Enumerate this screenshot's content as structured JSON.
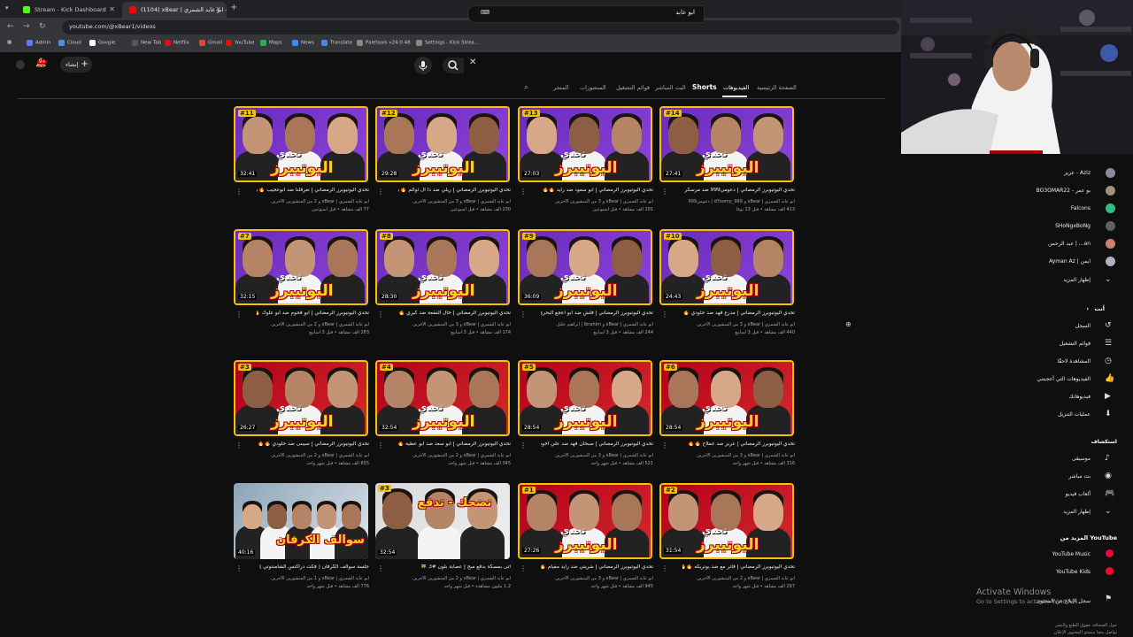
{
  "browser": {
    "tabs": [
      {
        "title": "Stream - Kick Dashboard",
        "icon": "kick-icon",
        "color": "#53fc18"
      },
      {
        "title": "(1104) xBear | ابو عابد الشمري - Y",
        "icon": "youtube-icon",
        "color": "#ff0000"
      }
    ],
    "url": "youtube.com/@xBear1/videos",
    "bookmarks": [
      {
        "label": "Admin",
        "color": "#5b7cfa"
      },
      {
        "label": "Cloud",
        "color": "#4a90e2"
      },
      {
        "label": "Google",
        "color": "#ffffff"
      },
      {
        "label": "New Tab",
        "color": "#555"
      },
      {
        "label": "Netflix",
        "color": "#e50914"
      },
      {
        "label": "Gmail",
        "color": "#ea4335"
      },
      {
        "label": "YouTube",
        "color": "#ff0000"
      },
      {
        "label": "Maps",
        "color": "#34a853"
      },
      {
        "label": "News",
        "color": "#4285f4"
      },
      {
        "label": "Translate",
        "color": "#4285f4"
      },
      {
        "label": "Paletools v24.0.48",
        "color": "#888"
      },
      {
        "label": "Settings - Kick Strea...",
        "color": "#888"
      }
    ]
  },
  "header": {
    "search_query": "ابو عابد",
    "create_label": "إنشاء",
    "notification_count": "9+"
  },
  "channel_tabs": [
    "الصفحة الرئيسية",
    "الفيديوهات",
    "Shorts",
    "البث المباشر",
    "قوائم التشغيل",
    "المنشورات",
    "المتجر"
  ],
  "videos": [
    {
      "title": "تحدي اليوتيوبرز الرمضاني | تعرقلنا ضد ابوعجيب 🔥🔥",
      "meta1": "ابو عابد الشمري | xBear و 2 من المنشورين الآخرين",
      "meta2": "77 ألف مشاهد • قبل أسبوعين",
      "duration": "32:41",
      "ep": "#11",
      "theme": "purple"
    },
    {
      "title": "تحدي اليوتيوبرز الرمضاني | ريلي ضد ذا ال ثوالم 🔥🔥",
      "meta1": "ابو عابد الشمري | xBear و 3 من المنشورين الآخرين",
      "meta2": "230 ألف مشاهد • قبل أسبوعين",
      "duration": "29:28",
      "ep": "#12",
      "theme": "purple"
    },
    {
      "title": "تحدي اليوتيوبرز الرمضاني | ابو سعود ضد رايد 🔥🔥",
      "meta1": "ابو عابد الشمري | xBear و 3 من المنشورين الآخرين",
      "meta2": "291 ألف مشاهد • قبل أسبوعين",
      "duration": "27:03",
      "ep": "#13",
      "theme": "purple"
    },
    {
      "title": "تحدي اليوتيوبرز الرمضاني | دعومي999 ضد مرسكر 🔥🔥",
      "meta1": "ابو عابد الشمري | xBear و d7oomy_999 | دعومي999",
      "meta2": "413 ألف مشاهد • قبل 13 يومًا",
      "duration": "27:41",
      "ep": "#14",
      "theme": "purple"
    },
    {
      "title": "تحدي اليوتيوبرز الرمضاني | ابو فحوم ضد ابو علوك 🔥🔥",
      "meta1": "ابو عابد الشمري | xBear و 2 من المنشورين الآخرين",
      "meta2": "283 ألف مشاهد • قبل 3 أسابيع",
      "duration": "32:15",
      "ep": "#7",
      "theme": "purple"
    },
    {
      "title": "تحدي اليوتيوبرز الرمضاني | خال الفقعة ضد كيري 🔥🔥",
      "meta1": "ابو عابد الشمري | xBear و 3 من المنشورين الآخرين",
      "meta2": "174 ألف مشاهد • قبل 3 أسابيع",
      "duration": "28:30",
      "ep": "#8",
      "theme": "purple"
    },
    {
      "title": "تحدي اليوتيوبرز الرمضاني | فلش ضد ابو اعجع البحري 🔥",
      "meta1": "ابو عابد الشمري | xBear و Ibrahim | ابراهيم خليل",
      "meta2": "244 ألف مشاهد • قبل 3 أسابيع",
      "duration": "36:09",
      "ep": "#9",
      "theme": "purple"
    },
    {
      "title": "تحدي اليوتيوبرز الرمضاني | مدرع فهد ضد حلودي 🔥🔥",
      "meta1": "ابو عابد الشمري | xBear و 3 من المنشورين الآخرين",
      "meta2": "440 ألف مشاهد • قبل 3 أسابيع",
      "duration": "24:43",
      "ep": "#10",
      "theme": "purple"
    },
    {
      "title": "تحدي اليوتيوبرز الرمضاني | سيبنى ضد حلودي 🔥🔥",
      "meta1": "ابو عابد الشمري | xBear و 2 من المنشورين الآخرين",
      "meta2": "655 ألف مشاهد • قبل شهر واحد",
      "duration": "26:27",
      "ep": "#3",
      "theme": "red"
    },
    {
      "title": "تحدي اليوتيوبرز الرمضاني | ابو سعد ضد ابو عطية 🔥🔥",
      "meta1": "ابو عابد الشمري | xBear و 2 من المنشورين الآخرين",
      "meta2": "345 ألف مشاهد • قبل شهر واحد",
      "duration": "32:54",
      "ep": "#4",
      "theme": "red"
    },
    {
      "title": "تحدي اليوتيوبرز الرمضاني | سبحان فهد ضد علي اخوه 🔥🔥",
      "meta1": "ابو عابد الشمري | xBear و 3 من المنشورين الآخرين",
      "meta2": "521 ألف مشاهد • قبل شهر واحد",
      "duration": "28:54",
      "ep": "#5",
      "theme": "red"
    },
    {
      "title": "تحدي اليوتيوبرز الرمضاني | عزيز ضد عملاح 🔥🔥",
      "meta1": "ابو عابد الشمري | xBear و 3 من المنشورين الآخرين",
      "meta2": "316 ألف مشاهد • قبل شهر واحد",
      "duration": "28:54",
      "ep": "#6",
      "theme": "red"
    },
    {
      "title": "جلسة سوالف الكرفان ( فكت دراكنس الشامنتوتي ) 🔥",
      "meta1": "ابو عابد الشمري | xBear و 1 من المنشورين الآخرين",
      "meta2": "776 ألف مشاهد • قبل شهر واحد",
      "duration": "40:16",
      "ep": "",
      "theme": "photo",
      "overlay": "سوالف الكرفان"
    },
    {
      "title": "اتى بمسكة بدقع سح | عصابة بلون #3 🍀",
      "meta1": "ابو عابد الشمري | xBear و 2 من المنشورين الآخرين",
      "meta2": "1.2 مليون مشاهدة • قبل شهر واحد",
      "duration": "32:54",
      "ep": "#3",
      "theme": "photo2",
      "overlay": "تضحك - تدفع"
    },
    {
      "title": "تحدي اليوتيوبرز الرمضاني | شريتي ضد رايد مقيام 🔥🔥",
      "meta1": "ابو عابد الشمري | xBear و 3 من المنشورين الآخرين",
      "meta2": "945 ألف مشاهد • قبل شهر واحد",
      "duration": "27:26",
      "ep": "#1",
      "theme": "red"
    },
    {
      "title": "تحدي اليوتيوبرز الرمضاني | فاتر مع ضد بوتريكه 🔥🔥",
      "meta1": "ابو عابد الشمري | xBear و 2 من المنشورين الآخرين",
      "meta2": "297 ألف مشاهد • قبل شهر واحد",
      "duration": "31:54",
      "ep": "#2",
      "theme": "red"
    }
  ],
  "thumb_overlay": {
    "top": "تحدي",
    "bottom": "اليوتيبرز"
  },
  "subscriptions": [
    {
      "name": "عزيز - Aziz",
      "color": "#8a8aa0"
    },
    {
      "name": "BO3OMAR22 - بو عمر",
      "color": "#a09080"
    },
    {
      "name": "Falcons",
      "color": "#2ebd85"
    },
    {
      "name": "SHoNgxBoNg",
      "color": "#606060"
    },
    {
      "name": "عبد الرحمن | ...an",
      "color": "#d08070"
    },
    {
      "name": "Ayman Az | ايمن",
      "color": "#b0b0c0"
    }
  ],
  "show_more": "إظهار المزيد",
  "you_section": {
    "header": "أنت",
    "items": [
      {
        "label": "السجل",
        "icon": "history-icon",
        "glyph": "↺"
      },
      {
        "label": "قوائم التشغيل",
        "icon": "playlists-icon",
        "glyph": "☰"
      },
      {
        "label": "المشاهدة لاحقًا",
        "icon": "watch-later-icon",
        "glyph": "◷"
      },
      {
        "label": "الفيديوهات التي أعجبتني",
        "icon": "like-icon",
        "glyph": "👍"
      },
      {
        "label": "فيديوهاتك",
        "icon": "your-videos-icon",
        "glyph": "▶"
      },
      {
        "label": "عمليات التنزيل",
        "icon": "download-icon",
        "glyph": "⬇"
      }
    ]
  },
  "explore_section": {
    "header": "استكشاف",
    "items": [
      {
        "label": "موسيقى",
        "icon": "music-icon",
        "glyph": "♪"
      },
      {
        "label": "بث مباشر",
        "icon": "live-icon",
        "glyph": "◉"
      },
      {
        "label": "ألعاب فيديو",
        "icon": "gaming-icon",
        "glyph": "🎮"
      },
      {
        "label": "إظهار المزيد",
        "icon": "chevron-down-icon",
        "glyph": "⌄"
      }
    ]
  },
  "more_section": {
    "header": "المزيد من YouTube",
    "items": [
      {
        "label": "YouTube Music",
        "icon": "youtube-music-icon"
      },
      {
        "label": "YouTube Kids",
        "icon": "youtube-kids-icon"
      }
    ]
  },
  "report_label": "سجل الإبلاغ عن المحتوى",
  "windows_watermark": {
    "title": "Activate Windows",
    "subtitle": "Go to Settings to activate Windows."
  },
  "footer_lines": [
    "حول   الصحافة   حقوق الطبع والنشر",
    "تواصل معنا   منشئو المحتوى   الإعلان"
  ]
}
